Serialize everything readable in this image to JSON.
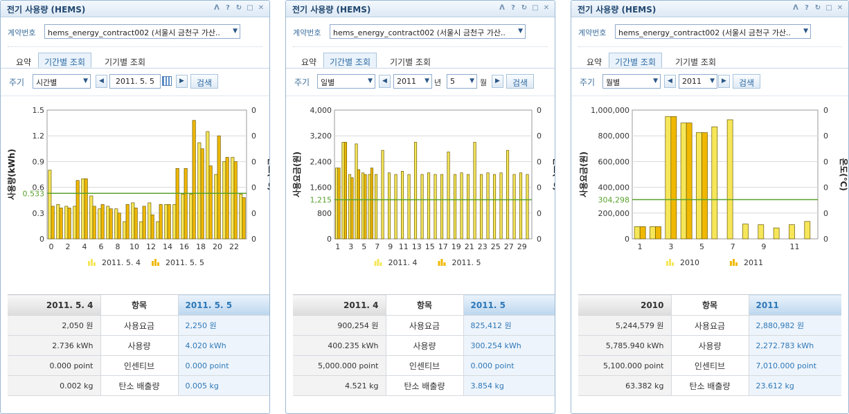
{
  "widgets": [
    {
      "title": "전기 사용량 (HEMS)",
      "contract_label": "계약번호",
      "contract_value": "hems_energy_contract002 (서울시 금천구 가산..",
      "tabs": [
        "요약",
        "기간별 조회",
        "기기별 조회"
      ],
      "active_tab": 1,
      "filter": {
        "period_label": "주기",
        "period_value": "시간별",
        "date_value": "2011. 5. 5",
        "search_label": "검색"
      },
      "table": {
        "header": {
          "left": "2011. 5. 4",
          "mid": "항목",
          "right": "2011. 5. 5"
        },
        "rows": [
          {
            "left": "2,050 원",
            "mid": "사용요금",
            "right": "2,250 원"
          },
          {
            "left": "2.736 kWh",
            "mid": "사용량",
            "right": "4.020 kWh"
          },
          {
            "left": "0.000 point",
            "mid": "인센티브",
            "right": "0.000 point"
          },
          {
            "left": "0.002 kg",
            "mid": "탄소 배출량",
            "right": "0.005 kg"
          }
        ]
      }
    },
    {
      "title": "전기 사용량 (HEMS)",
      "contract_label": "계약번호",
      "contract_value": "hems_energy_contract002 (서울시 금천구 가산..",
      "tabs": [
        "요약",
        "기간별 조회",
        "기기별 조회"
      ],
      "active_tab": 1,
      "filter": {
        "period_label": "주기",
        "period_value": "일별",
        "year_value": "2011",
        "year_unit": "년",
        "month_value": "5",
        "month_unit": "월",
        "search_label": "검색"
      },
      "table": {
        "header": {
          "left": "2011. 4",
          "mid": "항목",
          "right": "2011. 5"
        },
        "rows": [
          {
            "left": "900,254 원",
            "mid": "사용요금",
            "right": "825,412 원"
          },
          {
            "left": "400.235 kWh",
            "mid": "사용량",
            "right": "300.254 kWh"
          },
          {
            "left": "5,000.000 point",
            "mid": "인센티브",
            "right": "0.000 point"
          },
          {
            "left": "4.521 kg",
            "mid": "탄소 배출량",
            "right": "3.854 kg"
          }
        ]
      }
    },
    {
      "title": "전기 사용량 (HEMS)",
      "contract_label": "계약번호",
      "contract_value": "hems_energy_contract002 (서울시 금천구 가산..",
      "tabs": [
        "요약",
        "기간별 조회",
        "기기별 조회"
      ],
      "active_tab": 1,
      "filter": {
        "period_label": "주기",
        "period_value": "월별",
        "year_value": "2011",
        "search_label": "검색"
      },
      "table": {
        "header": {
          "left": "2010",
          "mid": "항목",
          "right": "2011"
        },
        "rows": [
          {
            "left": "5,244,579 원",
            "mid": "사용요금",
            "right": "2,880,982 원"
          },
          {
            "left": "5,785.940 kWh",
            "mid": "사용량",
            "right": "2,272.783 kWh"
          },
          {
            "left": "5,100.000 point",
            "mid": "인센티브",
            "right": "7,010.000 point"
          },
          {
            "left": "63.382 kg",
            "mid": "탄소 배출량",
            "right": "23.612 kg"
          }
        ]
      }
    }
  ],
  "colors": {
    "prev_bar": "#f6e65a",
    "curr_bar": "#f0b800",
    "avg_line": "#5aa02c",
    "accent": "#2d78b8"
  },
  "chart_data": [
    {
      "type": "bar",
      "ylabel": "사용량(kWh)",
      "y2label": "온도(℃)",
      "ylim": [
        0,
        1.5
      ],
      "yticks": [
        "0",
        "0.3",
        "0.6",
        "0.9",
        "1.2",
        "1.5"
      ],
      "y2ticks": [
        "0",
        "0",
        "0",
        "0",
        "0",
        "0"
      ],
      "xticks": [
        "0",
        "2",
        "4",
        "6",
        "8",
        "10",
        "12",
        "14",
        "16",
        "18",
        "20",
        "22"
      ],
      "avg_value": 0.53,
      "avg_label": "0.533",
      "categories": [
        "0",
        "1",
        "2",
        "3",
        "4",
        "5",
        "6",
        "7",
        "8",
        "9",
        "10",
        "11",
        "12",
        "13",
        "14",
        "15",
        "16",
        "17",
        "18",
        "19",
        "20",
        "21",
        "22",
        "23"
      ],
      "series": [
        {
          "name": "2011. 5. 4",
          "values": [
            0.8,
            0.4,
            0.38,
            0.38,
            0.7,
            0.5,
            0.35,
            0.38,
            0.35,
            0.2,
            0.42,
            0.2,
            0.42,
            0.2,
            0.4,
            0.4,
            0.52,
            0.52,
            1.12,
            1.25,
            0.75,
            0.9,
            0.95,
            0.52
          ]
        },
        {
          "name": "2011. 5. 5",
          "values": [
            0.38,
            0.36,
            0.36,
            0.68,
            0.7,
            0.38,
            0.4,
            0.35,
            0.3,
            0.4,
            0.36,
            0.38,
            0.28,
            0.4,
            0.4,
            0.82,
            0.82,
            1.38,
            1.05,
            0.85,
            1.2,
            0.95,
            0.9,
            0.48
          ]
        }
      ],
      "legend": [
        "2011. 5. 4",
        "2011. 5. 5"
      ]
    },
    {
      "type": "bar",
      "ylabel": "사용요금(원)",
      "y2label": "온도(℃)",
      "ylim": [
        0,
        4000
      ],
      "yticks": [
        "0",
        "800",
        "1,600",
        "2,400",
        "3,200",
        "4,000"
      ],
      "y2ticks": [
        "0",
        "0",
        "0",
        "0",
        "0",
        "0"
      ],
      "xticks": [
        "1",
        "3",
        "5",
        "7",
        "9",
        "11",
        "13",
        "15",
        "17",
        "19",
        "21",
        "23",
        "25",
        "27",
        "29"
      ],
      "avg_value": 1215,
      "avg_label": "1,215",
      "categories": [
        "1",
        "2",
        "3",
        "4",
        "5",
        "6",
        "7",
        "8",
        "9",
        "10",
        "11",
        "12",
        "13",
        "14",
        "15",
        "16",
        "17",
        "18",
        "19",
        "20",
        "21",
        "22",
        "23",
        "24",
        "25",
        "26",
        "27",
        "28",
        "29",
        "30"
      ],
      "series": [
        {
          "name": "2011. 4",
          "values": [
            2200,
            3000,
            2000,
            2950,
            2050,
            2000,
            2000,
            2750,
            2050,
            2000,
            2100,
            2000,
            3000,
            2000,
            2050,
            2000,
            2000,
            2700,
            2000,
            2050,
            2000,
            3000,
            2000,
            2050,
            2000,
            2050,
            2750,
            2000,
            2050,
            2000
          ]
        },
        {
          "name": "2011. 5",
          "values": [
            2200,
            3000,
            1900,
            2150,
            2000,
            2200
          ]
        }
      ],
      "legend": [
        "2011. 4",
        "2011. 5"
      ]
    },
    {
      "type": "bar",
      "ylabel": "사용요금(원)",
      "y2label": "온도(℃)",
      "ylim": [
        0,
        1000000
      ],
      "yticks": [
        "0",
        "200,000",
        "400,000",
        "600,000",
        "800,000",
        "1,000,000"
      ],
      "y2ticks": [
        "0",
        "0",
        "0",
        "0",
        "0",
        "0"
      ],
      "xticks": [
        "1",
        "3",
        "5",
        "7",
        "9",
        "11"
      ],
      "avg_value": 304298,
      "avg_label": "304,298",
      "categories": [
        "1",
        "2",
        "3",
        "4",
        "5",
        "6",
        "7",
        "8",
        "9",
        "10",
        "11",
        "12"
      ],
      "series": [
        {
          "name": "2010",
          "values": [
            95000,
            95000,
            950000,
            900000,
            825000,
            870000,
            925000,
            115000,
            110000,
            85000,
            110000,
            135000
          ]
        },
        {
          "name": "2011",
          "values": [
            95000,
            95000,
            950000,
            900000,
            825000
          ]
        }
      ],
      "legend": [
        "2010",
        "2011"
      ]
    }
  ]
}
